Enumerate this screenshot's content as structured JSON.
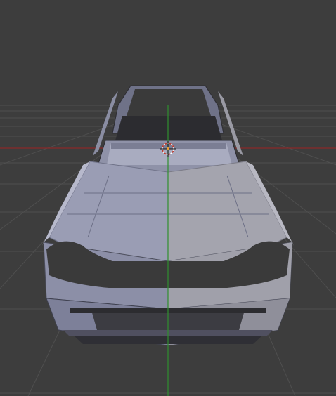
{
  "viewport": {
    "mode": "3d-viewport",
    "shading": "solid",
    "colors": {
      "background": "#3d3d3d",
      "grid": "#4f4f4f",
      "x_axis": "#8a2a2a",
      "y_axis": "#2f8f2f",
      "mesh_light": "#9a9db4",
      "mesh_mid": "#7d8099",
      "mesh_dark": "#5f6277",
      "mesh_right": "#a3a3ad",
      "cutout": "#3a3a3a",
      "edge": "#2d2d33",
      "cursor_ring_a": "#ffffff",
      "cursor_ring_b": "#c0392b"
    },
    "object": {
      "name_icon": "car-body-mesh-icon"
    },
    "cursor": {
      "icon": "3d-cursor-icon"
    }
  }
}
